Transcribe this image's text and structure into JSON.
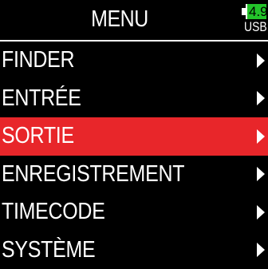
{
  "header": {
    "title": "MENU"
  },
  "battery": {
    "level": "4.9",
    "source": "USB",
    "color": "#23c32a"
  },
  "menu": {
    "selected_color": "#e8262a",
    "items": [
      {
        "label": "FINDER",
        "icon": "chevron-right-icon"
      },
      {
        "label": "ENTRÉE",
        "icon": "chevron-right-icon"
      },
      {
        "label": "SORTIE",
        "icon": "chevron-right-icon",
        "selected": true
      },
      {
        "label": "ENREGISTREMENT",
        "icon": "chevron-right-icon"
      },
      {
        "label": "TIMECODE",
        "icon": "chevron-right-icon"
      },
      {
        "label": "SYSTÈME",
        "icon": "chevron-right-icon"
      }
    ]
  }
}
